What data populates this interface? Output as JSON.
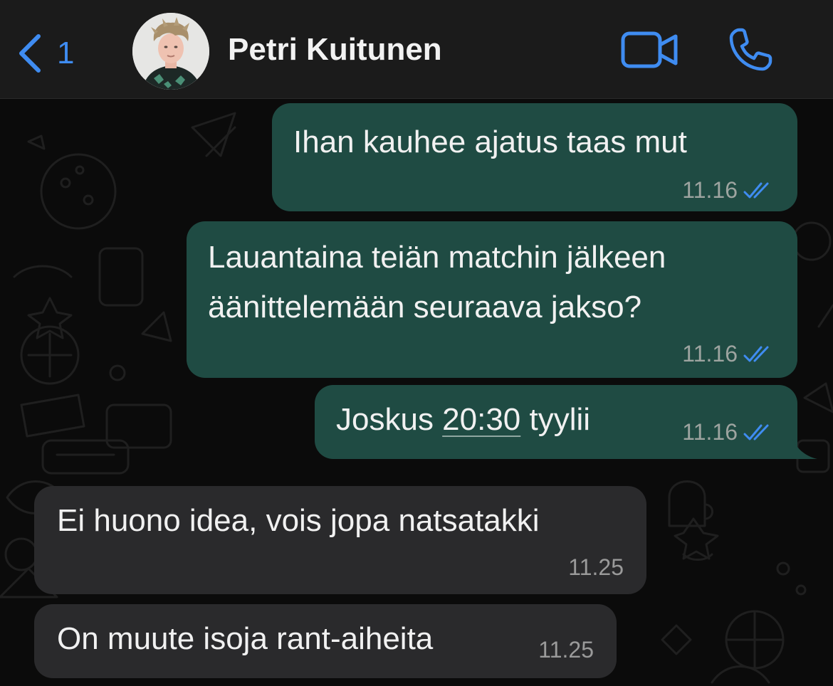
{
  "header": {
    "back_icon": "chevron-left-icon",
    "back_count": "1",
    "contact_name": "Petri Kuitunen",
    "video_icon": "video-camera-icon",
    "call_icon": "phone-icon",
    "accent_color": "#3f8cf1"
  },
  "messages": [
    {
      "direction": "outgoing",
      "lines": [
        "Ihan kauhee ajatus taas mut"
      ],
      "time": "11.16",
      "status": "read"
    },
    {
      "direction": "outgoing",
      "lines": [
        "Lauantaina teiän matchin jälkeen",
        "äänittelemään seuraava jakso?"
      ],
      "time": "11.16",
      "status": "read"
    },
    {
      "direction": "outgoing",
      "text_before": "Joskus ",
      "link_text": "20:30",
      "text_after": " tyylii",
      "time": "11.16",
      "status": "read"
    },
    {
      "direction": "incoming",
      "lines": [
        "Ei huono idea, vois jopa natsatakki"
      ],
      "time": "11.25"
    },
    {
      "direction": "incoming",
      "lines": [
        "On muute isoja rant-aiheita"
      ],
      "time": "11.25"
    }
  ],
  "colors": {
    "outgoing_bubble": "#1f4b43",
    "incoming_bubble": "#2a2a2c",
    "read_ticks": "#3f8cf1",
    "header_bg": "#1b1b1b"
  }
}
